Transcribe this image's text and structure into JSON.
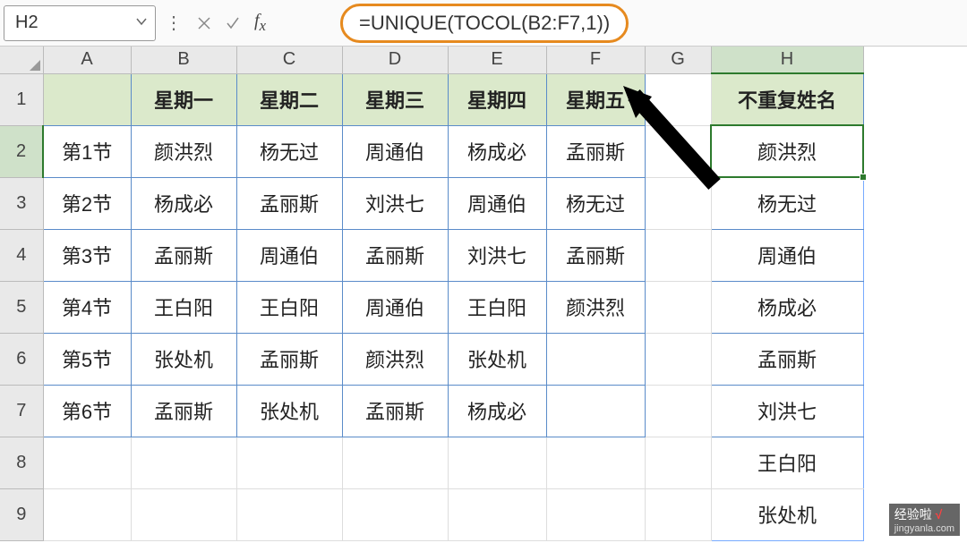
{
  "formula_bar": {
    "cell_ref": "H2",
    "formula": "=UNIQUE(TOCOL(B2:F7,1))"
  },
  "columns": [
    "A",
    "B",
    "C",
    "D",
    "E",
    "F",
    "G",
    "H"
  ],
  "rows": [
    "1",
    "2",
    "3",
    "4",
    "5",
    "6",
    "7",
    "8",
    "9"
  ],
  "headers": {
    "B1": "星期一",
    "C1": "星期二",
    "D1": "星期三",
    "E1": "星期四",
    "F1": "星期五",
    "H1": "不重复姓名"
  },
  "data": {
    "A2": "第1节",
    "B2": "颜洪烈",
    "C2": "杨无过",
    "D2": "周通伯",
    "E2": "杨成必",
    "F2": "孟丽斯",
    "A3": "第2节",
    "B3": "杨成必",
    "C3": "孟丽斯",
    "D3": "刘洪七",
    "E3": "周通伯",
    "F3": "杨无过",
    "A4": "第3节",
    "B4": "孟丽斯",
    "C4": "周通伯",
    "D4": "孟丽斯",
    "E4": "刘洪七",
    "F4": "孟丽斯",
    "A5": "第4节",
    "B5": "王白阳",
    "C5": "王白阳",
    "D5": "周通伯",
    "E5": "王白阳",
    "F5": "颜洪烈",
    "A6": "第5节",
    "B6": "张处机",
    "C6": "孟丽斯",
    "D6": "颜洪烈",
    "E6": "张处机",
    "A7": "第6节",
    "B7": "孟丽斯",
    "C7": "张处机",
    "D7": "孟丽斯",
    "E7": "杨成必"
  },
  "results": {
    "H2": "颜洪烈",
    "H3": "杨无过",
    "H4": "周通伯",
    "H5": "杨成必",
    "H6": "孟丽斯",
    "H7": "刘洪七",
    "H8": "王白阳",
    "H9": "张处机"
  },
  "watermark": {
    "brand": "经验啦",
    "domain": "jingyanla.com"
  }
}
